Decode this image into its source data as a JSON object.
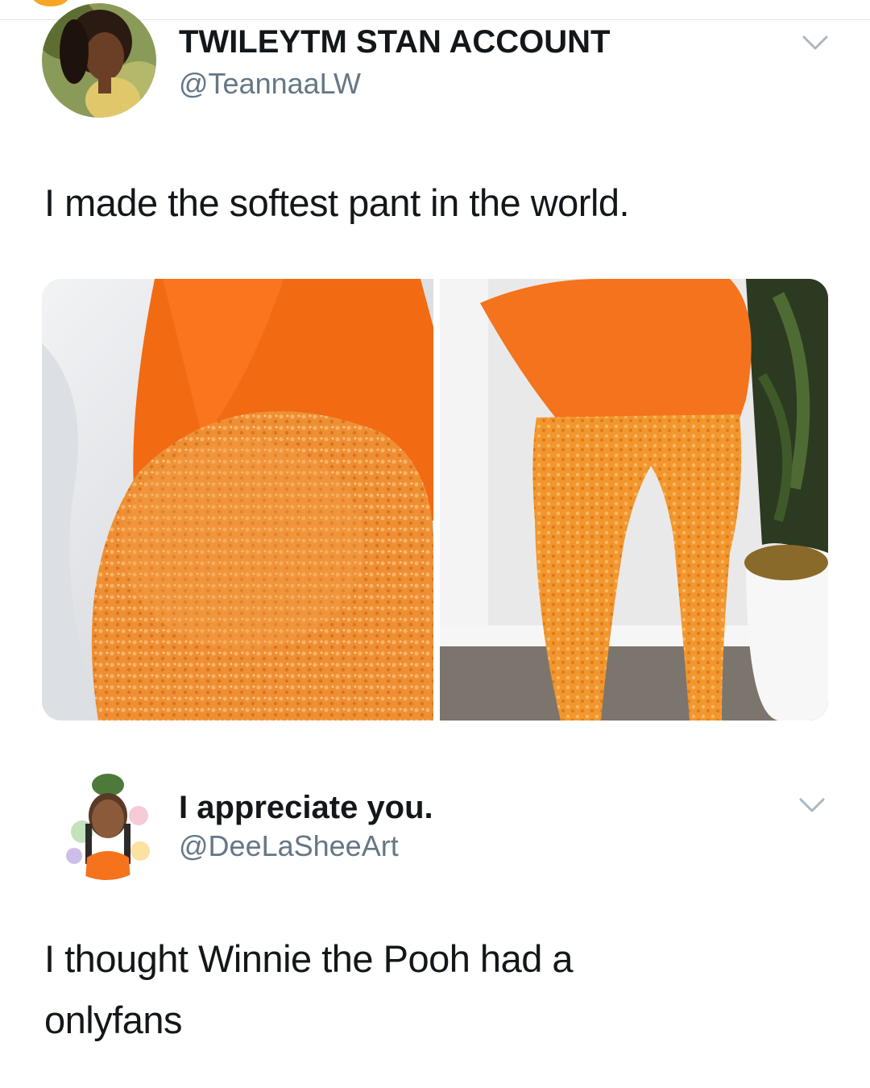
{
  "tweet": {
    "display_name": "TWILEYTM STAN ACCOUNT",
    "handle": "@TeannaaLW",
    "text": "I made the softest pant in the world.",
    "media": [
      {
        "icon": "photo-orange-fuzzy-pants-closeup"
      },
      {
        "icon": "photo-orange-fuzzy-pants-full"
      }
    ],
    "menu_icon": "chevron-down-icon"
  },
  "reply": {
    "display_name": "I appreciate you.",
    "handle": "@DeeLaSheeArt",
    "text_line1": "I thought Winnie the Pooh had a",
    "text_line2": "onlyfans",
    "menu_icon": "chevron-down-icon"
  },
  "colors": {
    "text": "#14171a",
    "secondary": "#657786",
    "divider": "#e1e8ed",
    "orange": "#f4731c",
    "fuzz": "#f09a3e"
  }
}
